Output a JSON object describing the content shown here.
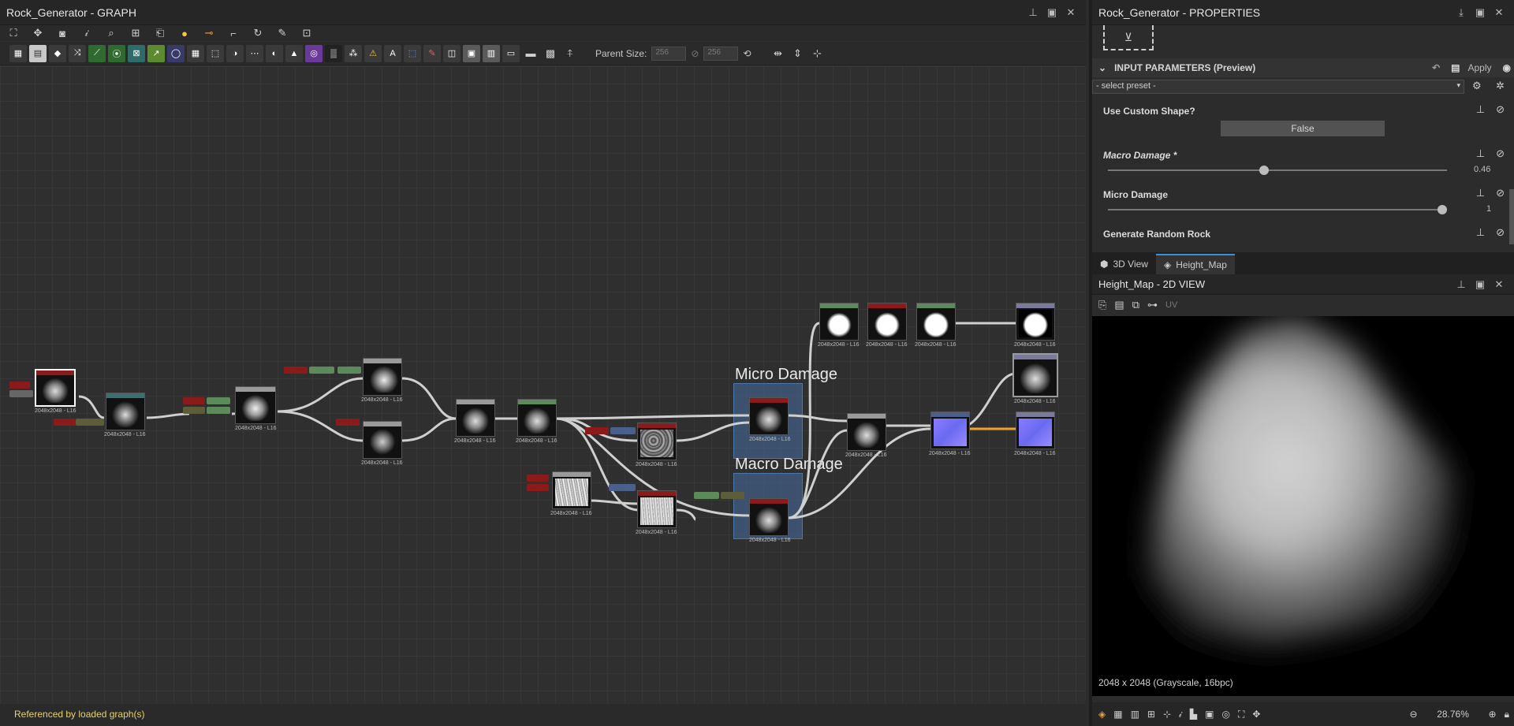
{
  "graph": {
    "title": "Rock_Generator - GRAPH",
    "parent_size_label": "Parent Size:",
    "parent_size_value": "256",
    "parent_size_value2": "256",
    "status": "Referenced by loaded graph(s)",
    "frames": [
      {
        "label": "Micro Damage"
      },
      {
        "label": "Macro Damage"
      }
    ],
    "node_res": "2048x2048 - L16"
  },
  "properties": {
    "title": "Rock_Generator - PROPERTIES",
    "section": "INPUT PARAMETERS (Preview)",
    "apply_label": "Apply",
    "preset": "- select preset -",
    "params": [
      {
        "label": "Use Custom Shape?",
        "value": "False"
      },
      {
        "label": "Macro Damage *",
        "value": "0.46",
        "fraction": 0.46
      },
      {
        "label": "Micro Damage",
        "value": "1",
        "fraction": 1.0
      },
      {
        "label": "Generate Random Rock"
      }
    ]
  },
  "view_tabs": [
    {
      "label": "3D View"
    },
    {
      "label": "Height_Map"
    }
  ],
  "view2d": {
    "title": "Height_Map - 2D VIEW",
    "uv_label": "UV",
    "info": "2048 x 2048 (Grayscale, 16bpc)",
    "zoom": "28.76%"
  },
  "colors": {
    "accent": "#3d8fd7",
    "status_text": "#e5d36a",
    "frame": "#466ea0",
    "node_red": "#8b1a1a",
    "node_green": "#5d8a5a",
    "node_gray": "#9a9a9a",
    "node_teal": "#3e6e6e",
    "wire_orange": "#f0a030"
  },
  "icons": [
    "pin-icon",
    "maximize-icon",
    "close-icon",
    "eye-icon",
    "gear-icon",
    "reset-icon",
    "save-icon",
    "lock-icon"
  ]
}
